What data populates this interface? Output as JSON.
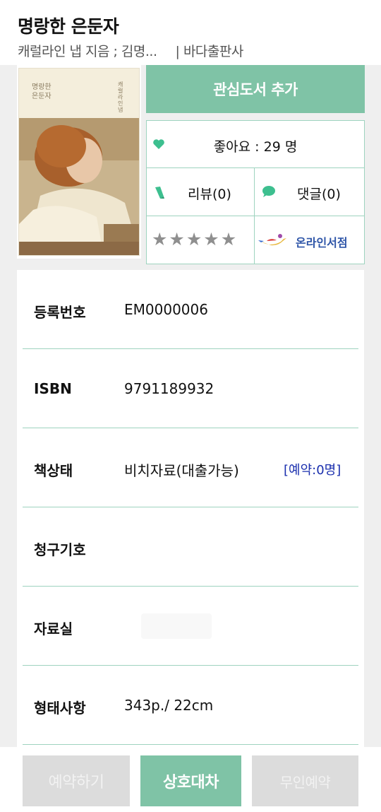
{
  "book": {
    "title": "명랑한 은둔자",
    "authors": "캐럴라인 냅 지음 ; 김명...",
    "publisher": "| 바다출판사"
  },
  "cover": {
    "title_line1": "명랑한",
    "title_line2": "은둔자",
    "spine_text": "캐럴라인냅"
  },
  "actions": {
    "interest_label": "관심도서 추가",
    "likes_label": "좋아요 : 29 명",
    "review_label": "리뷰(0)",
    "comment_label": "댓글(0)",
    "online_store_label": "온라인서점",
    "stars": [
      "★",
      "★",
      "★",
      "★",
      "★"
    ]
  },
  "details": [
    {
      "key": "등록번호",
      "value": "EM0000006"
    },
    {
      "key": "ISBN",
      "value": "9791189932"
    },
    {
      "key": "책상태",
      "value": "비치자료(대출가능)",
      "extra": "[예약:0명]"
    },
    {
      "key": "청구기호",
      "value": ""
    },
    {
      "key": "자료실",
      "value": ""
    },
    {
      "key": "형태사항",
      "value": "343p./ 22cm"
    }
  ],
  "bottom": {
    "reserve_label": "예약하기",
    "ill_label": "상호대차",
    "unmanned_label": "무인예약"
  },
  "colors": {
    "accent": "#7fc3a6",
    "divider": "#9ed3bf",
    "disabled": "#dcdcdc",
    "link_blue": "#1a2fae",
    "star_gray": "#8f8f8f"
  }
}
